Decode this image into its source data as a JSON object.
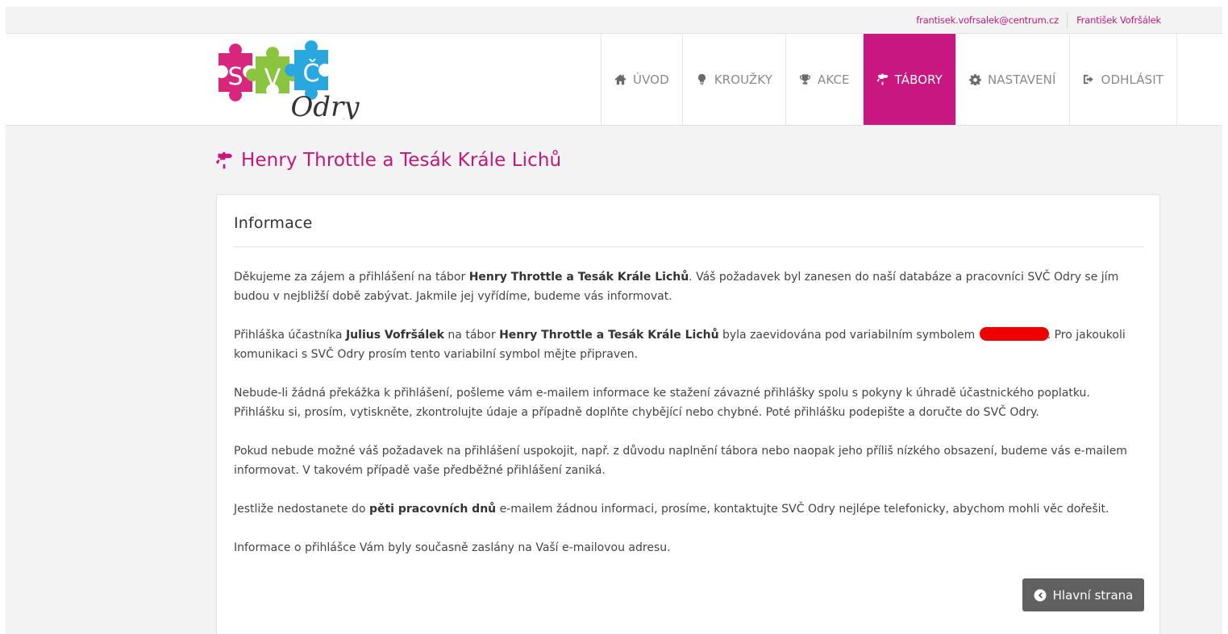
{
  "topbar": {
    "email": "frantisek.vofrsalek@centrum.cz",
    "user_name": "František Vofršálek"
  },
  "logo": {
    "letters": [
      "S",
      "V",
      "Č"
    ],
    "subtitle": "Odry",
    "colors": [
      "#d9267d",
      "#8bc53f",
      "#29a8e0"
    ]
  },
  "nav": {
    "items": [
      {
        "label": "ÚVOD",
        "icon": "home-icon"
      },
      {
        "label": "KROUŽKY",
        "icon": "lightbulb-icon"
      },
      {
        "label": "AKCE",
        "icon": "trophy-icon"
      },
      {
        "label": "TÁBORY",
        "icon": "signpost-icon",
        "active": true
      },
      {
        "label": "NASTAVENÍ",
        "icon": "gear-icon"
      },
      {
        "label": "ODHLÁSIT",
        "icon": "sign-out-icon"
      }
    ]
  },
  "page": {
    "title": "Henry Throttle a Tesák Krále Lichů",
    "title_icon": "signpost-icon"
  },
  "panel": {
    "heading": "Informace",
    "p1": {
      "a": "Děkujeme za zájem a přihlášení na tábor ",
      "b": "Henry Throttle a Tesák Krále Lichů",
      "c": ". Váš požadavek byl zanesen do naší databáze a pracovníci SVČ Odry se jím budou v nejbližší době zabývat. Jakmile jej vyřídíme, budeme vás informovat."
    },
    "p2": {
      "a": "Přihláška účastníka ",
      "b": "Julius Vofršálek",
      "c": " na tábor ",
      "d": "Henry Throttle a Tesák Krále Lichů",
      "e": " byla zaevidována pod variabilním symbolem ",
      "f": ". Pro jakoukoli komunikaci s SVČ Odry prosím tento variabilní symbol mějte připraven."
    },
    "p3": "Nebude-li žádná překážka k přihlášení, pošleme vám e-mailem informace ke stažení závazné přihlášky spolu s pokyny k úhradě účastnického poplatku. Přihlášku si, prosím, vytiskněte, zkontrolujte údaje a případně doplňte chybějící nebo chybné. Poté přihlášku podepište a doručte do SVČ Odry.",
    "p4": "Pokud nebude možné váš požadavek na přihlášení uspokojit, např. z důvodu naplnění tábora nebo naopak jeho příliš nízkého obsazení, budeme vás e-mailem informovat. V takovém případě vaše předběžné přihlášení zaniká.",
    "p5": {
      "a": "Jestliže nedostanete do ",
      "b": "pěti pracovních dnů",
      "c": " e-mailem žádnou informaci, prosíme, kontaktujte SVČ Odry nejlépe telefonicky, abychom mohli věc dořešit."
    },
    "p6": "Informace o přihlášce Vám byly současně zaslány na Vaší e-mailovou adresu.",
    "button": "Hlavní strana"
  },
  "colors": {
    "accent": "#c8177e",
    "button": "#606060",
    "redaction": "#ee0000"
  }
}
